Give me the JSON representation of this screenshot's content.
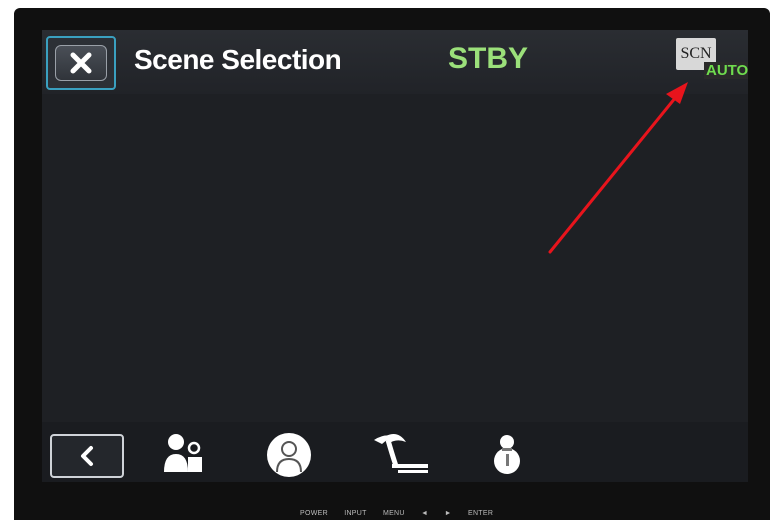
{
  "header": {
    "title": "Scene Selection",
    "status": "STBY",
    "scene_badge": "SCN",
    "mode_badge": "AUTO"
  },
  "buttons": {
    "close_icon": "close-icon",
    "back_icon": "chevron-left-icon"
  },
  "scene_modes": [
    {
      "icon": "portrait-group-icon"
    },
    {
      "icon": "person-circle-icon"
    },
    {
      "icon": "beach-palm-icon"
    },
    {
      "icon": "snowman-icon"
    }
  ],
  "monitor_controls": [
    "POWER",
    "INPUT",
    "MENU",
    "◄",
    "►",
    "ENTER"
  ],
  "colors": {
    "accent_border": "#3aa0c0",
    "status_green": "#9be07a",
    "auto_green": "#6fdc4e",
    "annotation_arrow": "#e8141c"
  }
}
